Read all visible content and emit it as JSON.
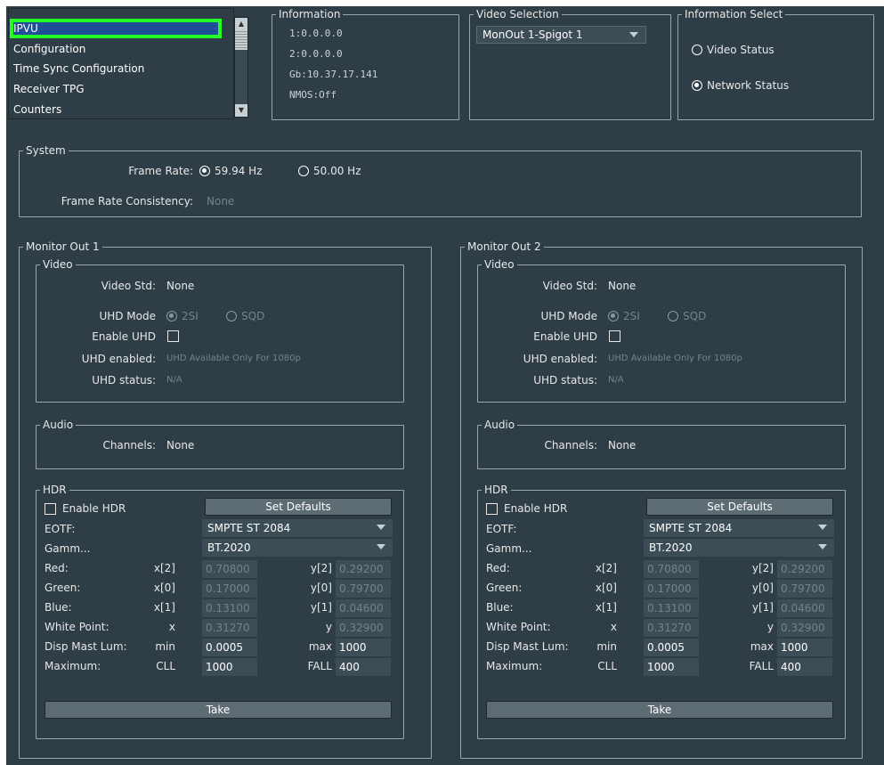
{
  "nav": {
    "items": [
      "IPVU",
      "Configuration",
      "Time Sync Configuration",
      "Receiver TPG",
      "Counters"
    ],
    "selected": "IPVU"
  },
  "information": {
    "title": "Information",
    "lines": [
      "1:0.0.0.0",
      "2:0.0.0.0",
      "Gb:10.37.17.141",
      "NMOS:Off"
    ]
  },
  "video_selection": {
    "title": "Video Selection",
    "value": "MonOut 1-Spigot 1"
  },
  "info_select": {
    "title": "Information Select",
    "options": [
      "Video Status",
      "Network Status"
    ],
    "selected": "Network Status"
  },
  "system": {
    "title": "System",
    "frame_rate_label": "Frame Rate:",
    "frame_rate_options": [
      "59.94 Hz",
      "50.00 Hz"
    ],
    "frame_rate_selected": "59.94 Hz",
    "consistency_label": "Frame Rate Consistency:",
    "consistency_value": "None"
  },
  "monitors": [
    {
      "title": "Monitor Out 1",
      "video_title": "Video",
      "video_std_label": "Video Std:",
      "video_std": "None",
      "uhd_mode_label": "UHD Mode",
      "uhd_mode_options": [
        "2SI",
        "SQD"
      ],
      "uhd_mode_selected": "2SI",
      "enable_uhd_label": "Enable UHD",
      "uhd_enabled_label": "UHD enabled:",
      "uhd_enabled_value": "UHD Available Only For 1080p",
      "uhd_status_label": "UHD status:",
      "uhd_status_value": "N/A",
      "audio_title": "Audio",
      "channels_label": "Channels:",
      "channels_value": "None",
      "hdr": {
        "title": "HDR",
        "enable_label": "Enable HDR",
        "set_defaults": "Set Defaults",
        "eotf_label": "EOTF:",
        "eotf_value": "SMPTE ST 2084",
        "gamut_label": "Gamm...",
        "gamut_value": "BT.2020",
        "rows": [
          {
            "label": "Red:",
            "xk": "x[2]",
            "xv": "0.70800",
            "yk": "y[2]",
            "yv": "0.29200"
          },
          {
            "label": "Green:",
            "xk": "x[0]",
            "xv": "0.17000",
            "yk": "y[0]",
            "yv": "0.79700"
          },
          {
            "label": "Blue:",
            "xk": "x[1]",
            "xv": "0.13100",
            "yk": "y[1]",
            "yv": "0.04600"
          },
          {
            "label": "White Point:",
            "xk": "x",
            "xv": "0.31270",
            "yk": "y",
            "yv": "0.32900"
          },
          {
            "label": "Disp Mast Lum:",
            "xk": "min",
            "xv": "0.0005",
            "yk": "max",
            "yv": "1000"
          },
          {
            "label": "Maximum:",
            "xk": "CLL",
            "xv": "1000",
            "yk": "FALL",
            "yv": "400"
          }
        ],
        "take": "Take"
      }
    },
    {
      "title": "Monitor Out 2",
      "video_title": "Video",
      "video_std_label": "Video Std:",
      "video_std": "None",
      "uhd_mode_label": "UHD Mode",
      "uhd_mode_options": [
        "2SI",
        "SQD"
      ],
      "uhd_mode_selected": "2SI",
      "enable_uhd_label": "Enable UHD",
      "uhd_enabled_label": "UHD enabled:",
      "uhd_enabled_value": "UHD Available Only For 1080p",
      "uhd_status_label": "UHD status:",
      "uhd_status_value": "N/A",
      "audio_title": "Audio",
      "channels_label": "Channels:",
      "channels_value": "None",
      "hdr": {
        "title": "HDR",
        "enable_label": "Enable HDR",
        "set_defaults": "Set Defaults",
        "eotf_label": "EOTF:",
        "eotf_value": "SMPTE ST 2084",
        "gamut_label": "Gamm...",
        "gamut_value": "BT.2020",
        "rows": [
          {
            "label": "Red:",
            "xk": "x[2]",
            "xv": "0.70800",
            "yk": "y[2]",
            "yv": "0.29200"
          },
          {
            "label": "Green:",
            "xk": "x[0]",
            "xv": "0.17000",
            "yk": "y[0]",
            "yv": "0.79700"
          },
          {
            "label": "Blue:",
            "xk": "x[1]",
            "xv": "0.13100",
            "yk": "y[1]",
            "yv": "0.04600"
          },
          {
            "label": "White Point:",
            "xk": "x",
            "xv": "0.31270",
            "yk": "y",
            "yv": "0.32900"
          },
          {
            "label": "Disp Mast Lum:",
            "xk": "min",
            "xv": "0.0005",
            "yk": "max",
            "yv": "1000"
          },
          {
            "label": "Maximum:",
            "xk": "CLL",
            "xv": "1000",
            "yk": "FALL",
            "yv": "400"
          }
        ],
        "take": "Take"
      }
    }
  ],
  "colors": {
    "panel_bg": "#2f3e46",
    "selection": "#1f4f99",
    "highlight_outline": "#22ff22",
    "disabled_text": "#6f8590"
  }
}
